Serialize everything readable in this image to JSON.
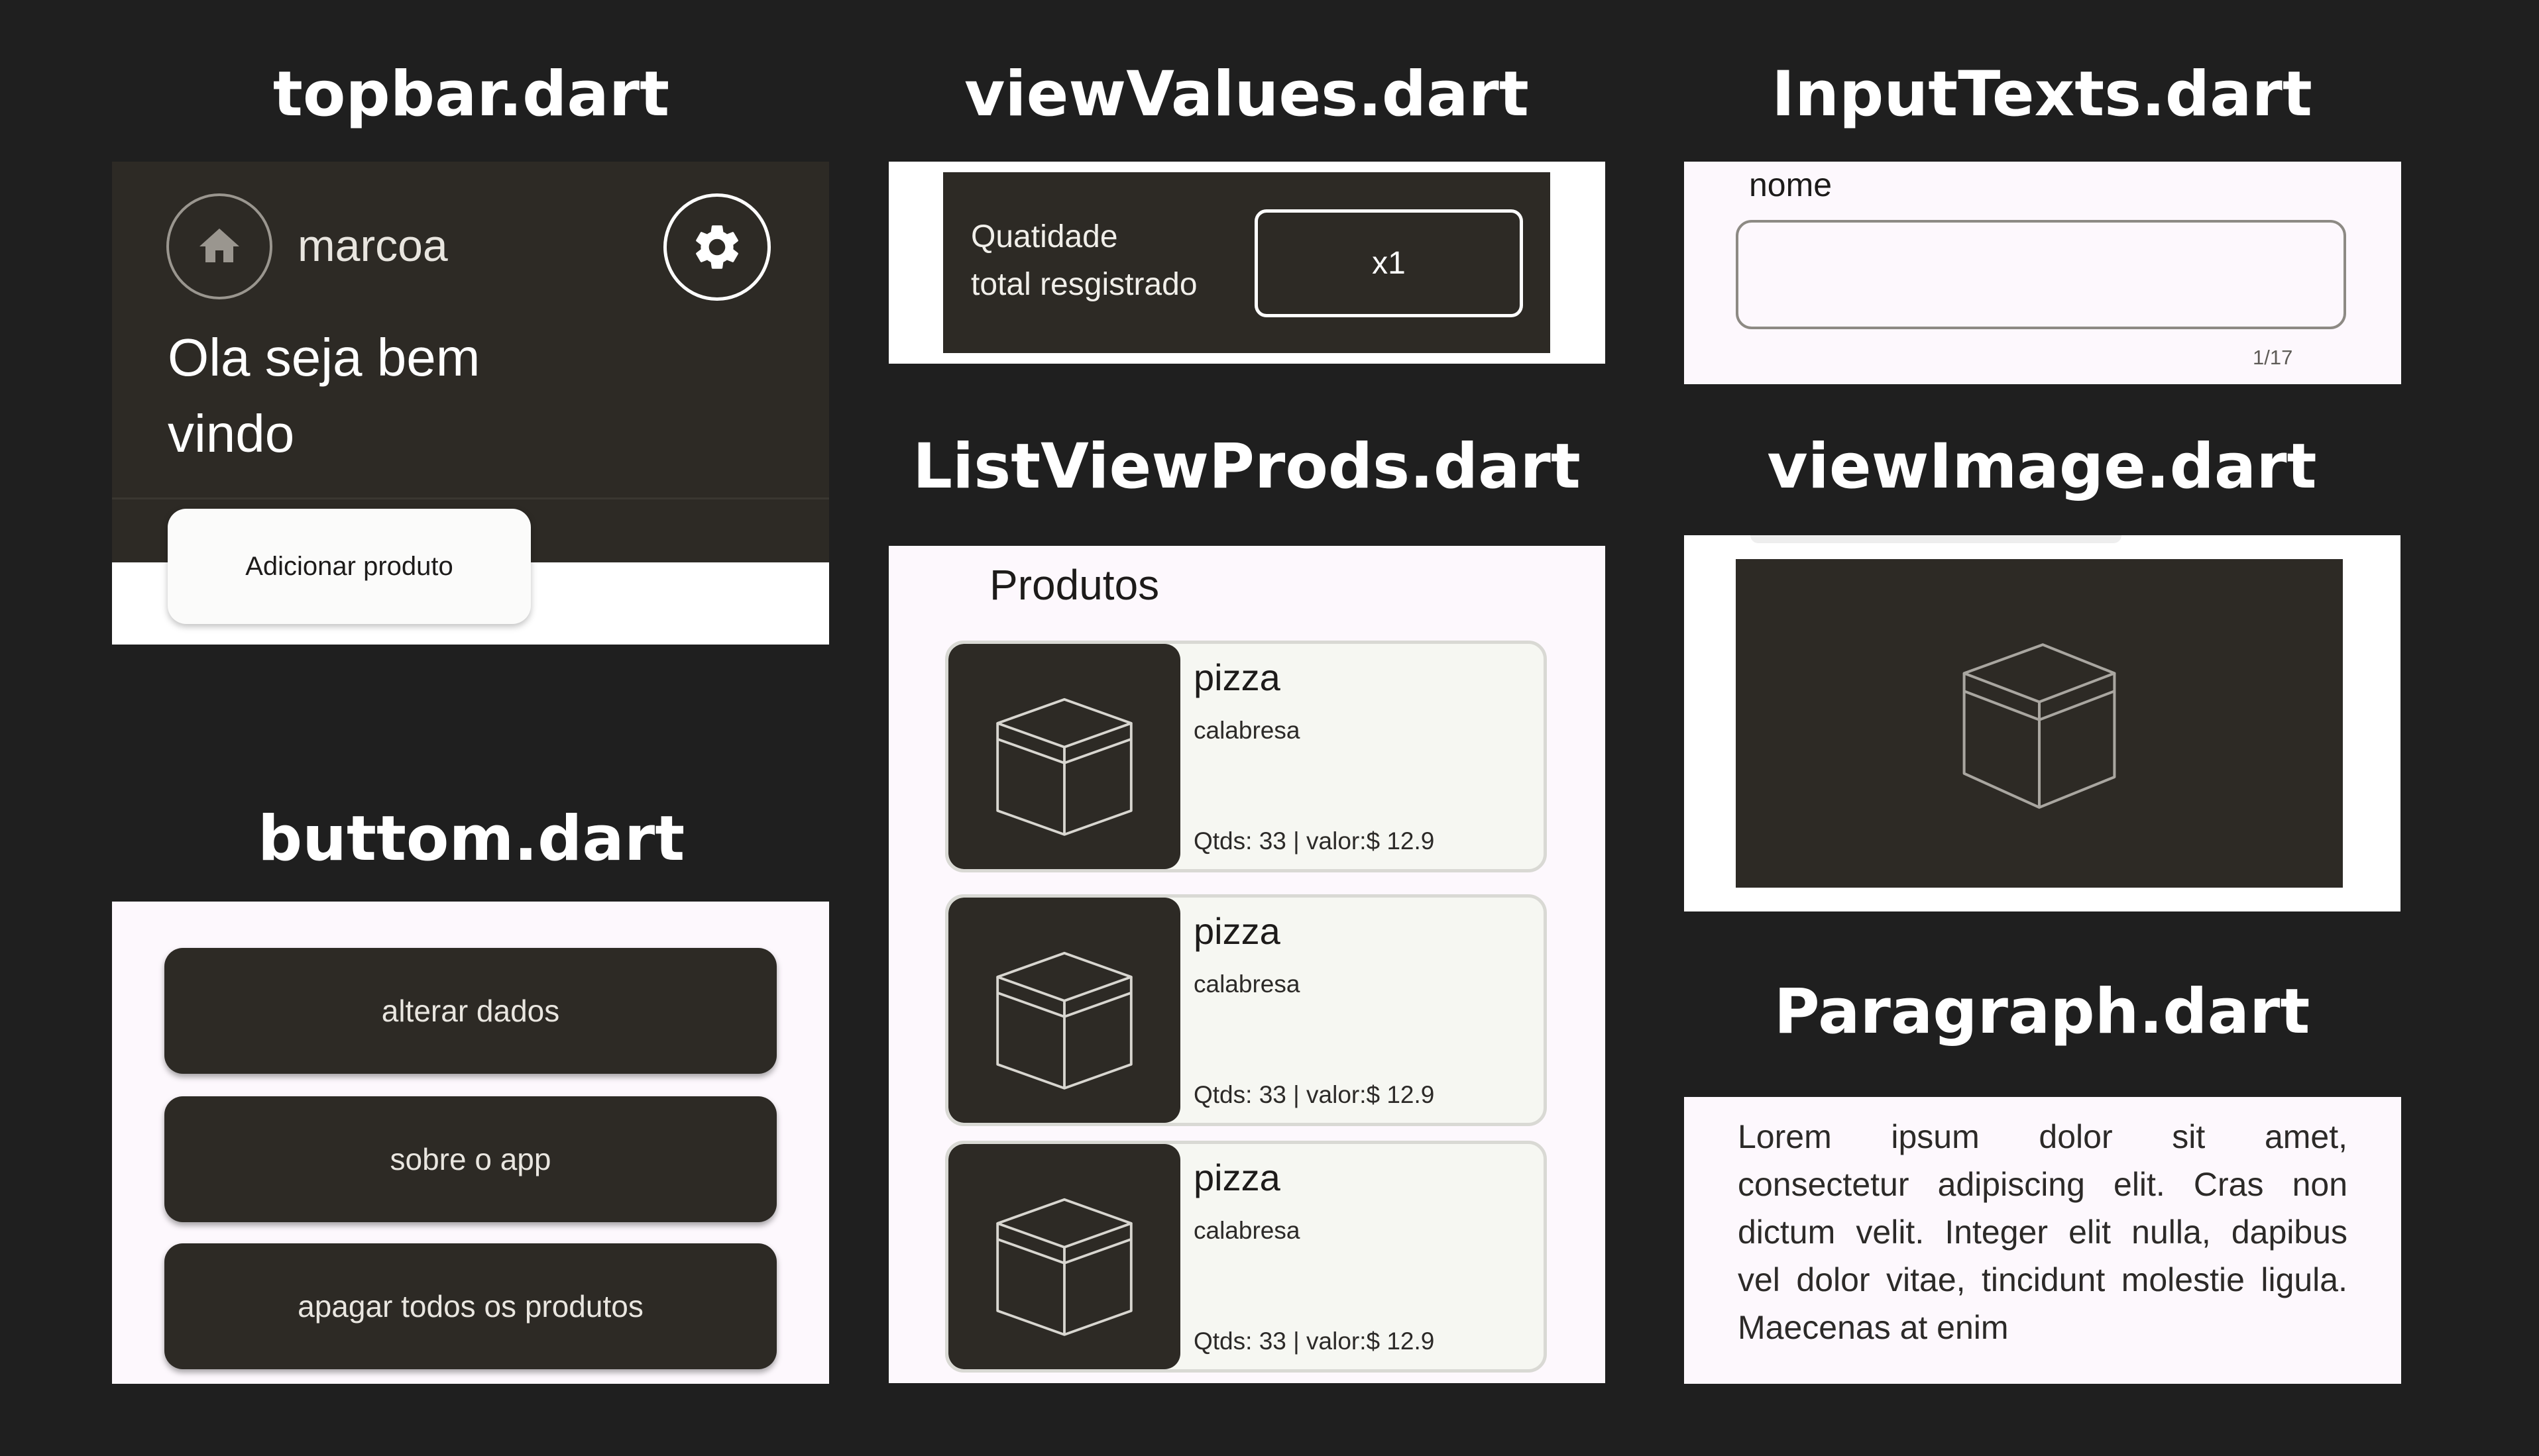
{
  "titles": {
    "topbar": "topbar.dart",
    "viewvalues": "viewValues.dart",
    "inputtexts": "InputTexts.dart",
    "listviewprods": "ListViewProds.dart",
    "viewimage": "viewImage.dart",
    "buttom": "buttom.dart",
    "paragraph": "Paragraph.dart"
  },
  "topbar": {
    "username": "marcoa",
    "greeting_line1": "Ola seja bem",
    "greeting_line2": "vindo",
    "add_product_label": "Adicionar produto"
  },
  "view_values": {
    "label_line1": "Quatidade",
    "label_line2": "total resgistrado",
    "value": "x1"
  },
  "input_texts": {
    "field_label": "nome",
    "counter": "1/17"
  },
  "list_view": {
    "heading": "Produtos",
    "products": [
      {
        "name": "pizza",
        "description": "calabresa",
        "info": "Qtds: 33 | valor:$ 12.9"
      },
      {
        "name": "pizza",
        "description": "calabresa",
        "info": "Qtds: 33 | valor:$ 12.9"
      },
      {
        "name": "pizza",
        "description": "calabresa",
        "info": "Qtds: 33 | valor:$ 12.9"
      }
    ]
  },
  "buttons": {
    "alter": "alterar dados",
    "about": "sobre o app",
    "delete_all": "apagar todos os produtos"
  },
  "paragraph": {
    "line1": "Lorem ipsum dolor sit amet,",
    "line2": "consectetur adipiscing elit. Cras non",
    "line3": "dictum velit. Integer elit nulla, dapibus",
    "line4": "vel dolor vitae, tincidunt molestie ligula.",
    "line5": "Maecenas at enim"
  },
  "icons": {
    "home": "home-icon",
    "settings": "gear-icon",
    "product": "cube-icon"
  },
  "colors": {
    "background": "#1f1f1f",
    "dark_surface": "#2d2a25",
    "light_surface": "#fdf8fd",
    "card_surface": "#f6f7f2"
  }
}
